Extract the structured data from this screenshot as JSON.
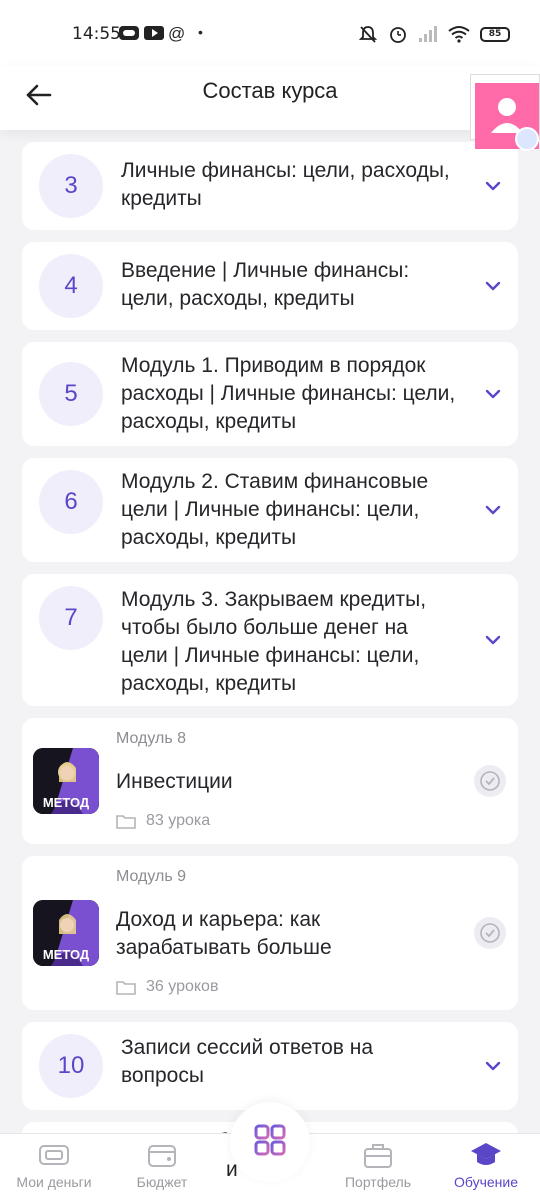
{
  "status_bar": {
    "time": "14:55",
    "battery": "85"
  },
  "header": {
    "title": "Состав курса"
  },
  "sections": [
    {
      "number": "3",
      "title": "Личные финансы: цели, расходы, кредиты"
    },
    {
      "number": "4",
      "title": "Введение | Личные финансы: цели, расходы, кредиты"
    },
    {
      "number": "5",
      "title": "Модуль 1. Приводим в порядок расходы | Личные финансы: цели, расходы, кредиты"
    },
    {
      "number": "6",
      "title": "Модуль 2. Ставим финансовые цели | Личные финансы: цели, расходы, кредиты"
    },
    {
      "number": "7",
      "title": "Модуль 3. Закрываем кредиты, чтобы было больше денег на цели | Личные финансы: цели, расходы, кредиты"
    }
  ],
  "modules": [
    {
      "label": "Модуль 8",
      "title": "Инвестиции",
      "lessons": "83 урока",
      "thumb_text": "МЕТОД"
    },
    {
      "label": "Модуль 9",
      "title": "Доход и карьера: как зарабатывать больше",
      "lessons": "36 уроков",
      "thumb_text": "МЕТОД"
    }
  ],
  "section_10": {
    "number": "10",
    "title": "Записи сессий ответов на вопросы"
  },
  "peek_text": {
    "line1": "б",
    "line2": "е",
    "line3": "и"
  },
  "bottom_nav": [
    {
      "label": "Мои деньги",
      "icon": "wallet-icon",
      "active": false
    },
    {
      "label": "Бюджет",
      "icon": "budget-icon",
      "active": false
    },
    {
      "label": "",
      "icon": "grid-icon",
      "active": false
    },
    {
      "label": "Портфель",
      "icon": "briefcase-icon",
      "active": false
    },
    {
      "label": "Обучение",
      "icon": "graduation-cap-icon",
      "active": true
    }
  ],
  "colors": {
    "accent": "#5a47c8",
    "circle_bg": "#f1eefb",
    "background": "#f3f3f5",
    "card": "#ffffff",
    "pink_widget": "#ff6aa8"
  }
}
